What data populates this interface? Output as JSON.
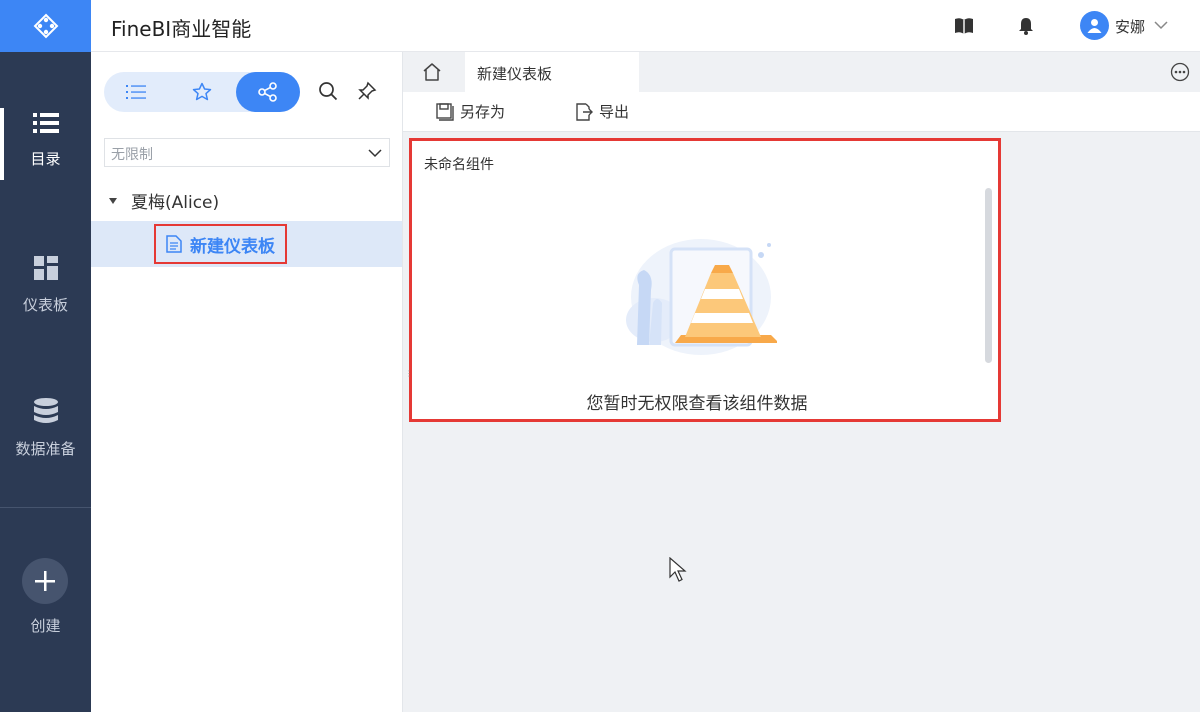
{
  "app": {
    "title": "FineBI商业智能"
  },
  "nav": {
    "items": [
      {
        "label": "目录",
        "icon": "catalog-list-icon",
        "active": true
      },
      {
        "label": "仪表板",
        "icon": "dashboard-grid-icon",
        "active": false
      },
      {
        "label": "数据准备",
        "icon": "database-icon",
        "active": false
      }
    ],
    "create_label": "创建"
  },
  "header": {
    "icons": [
      "book-icon",
      "bell-icon"
    ],
    "user": {
      "name": "安娜"
    }
  },
  "panel": {
    "segments": [
      "list-icon",
      "star-icon",
      "share-icon"
    ],
    "active_segment": 2,
    "filter": {
      "value": "无限制"
    },
    "tree": {
      "owner": "夏梅(Alice)",
      "items": [
        {
          "label": "新建仪表板",
          "selected": true
        }
      ]
    }
  },
  "main": {
    "tab": {
      "label": "新建仪表板"
    },
    "toolbar": {
      "save_as": "另存为",
      "export": "导出"
    },
    "widget": {
      "title": "未命名组件",
      "message": "您暂时无权限查看该组件数据"
    }
  },
  "colors": {
    "accent": "#3d86f5",
    "nav_bg": "#2c3a54",
    "highlight": "#e53935"
  }
}
